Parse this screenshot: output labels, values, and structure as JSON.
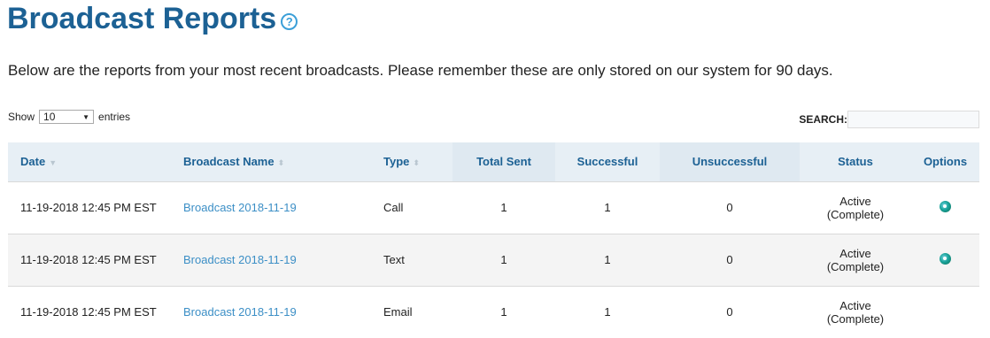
{
  "header": {
    "title": "Broadcast Reports",
    "help_icon": "question-circle-icon",
    "intro": "Below are the reports from your most recent broadcasts. Please remember these are only stored on our system for 90 days."
  },
  "controls": {
    "show_label": "Show",
    "entries_value": "10",
    "entries_label": "entries",
    "search_label": "SEARCH:",
    "search_value": ""
  },
  "table": {
    "columns": [
      "Date",
      "Broadcast Name",
      "Type",
      "Total Sent",
      "Successful",
      "Unsuccessful",
      "Status",
      "Options"
    ],
    "rows": [
      {
        "date": "11-19-2018 12:45 PM EST",
        "name": "Broadcast 2018-11-19",
        "type": "Call",
        "total": "1",
        "successful": "1",
        "unsuccessful": "0",
        "status1": "Active",
        "status2": "(Complete)",
        "option_icon": "report-globe-icon"
      },
      {
        "date": "11-19-2018 12:45 PM EST",
        "name": "Broadcast 2018-11-19",
        "type": "Text",
        "total": "1",
        "successful": "1",
        "unsuccessful": "0",
        "status1": "Active",
        "status2": "(Complete)",
        "option_icon": "report-globe-icon"
      },
      {
        "date": "11-19-2018 12:45 PM EST",
        "name": "Broadcast 2018-11-19",
        "type": "Email",
        "total": "1",
        "successful": "1",
        "unsuccessful": "0",
        "status1": "Active",
        "status2": "(Complete)",
        "option_icon": ""
      }
    ]
  },
  "colors": {
    "title": "#1c6194",
    "link": "#3c8fc6",
    "header_bg": "#e7eff5"
  }
}
